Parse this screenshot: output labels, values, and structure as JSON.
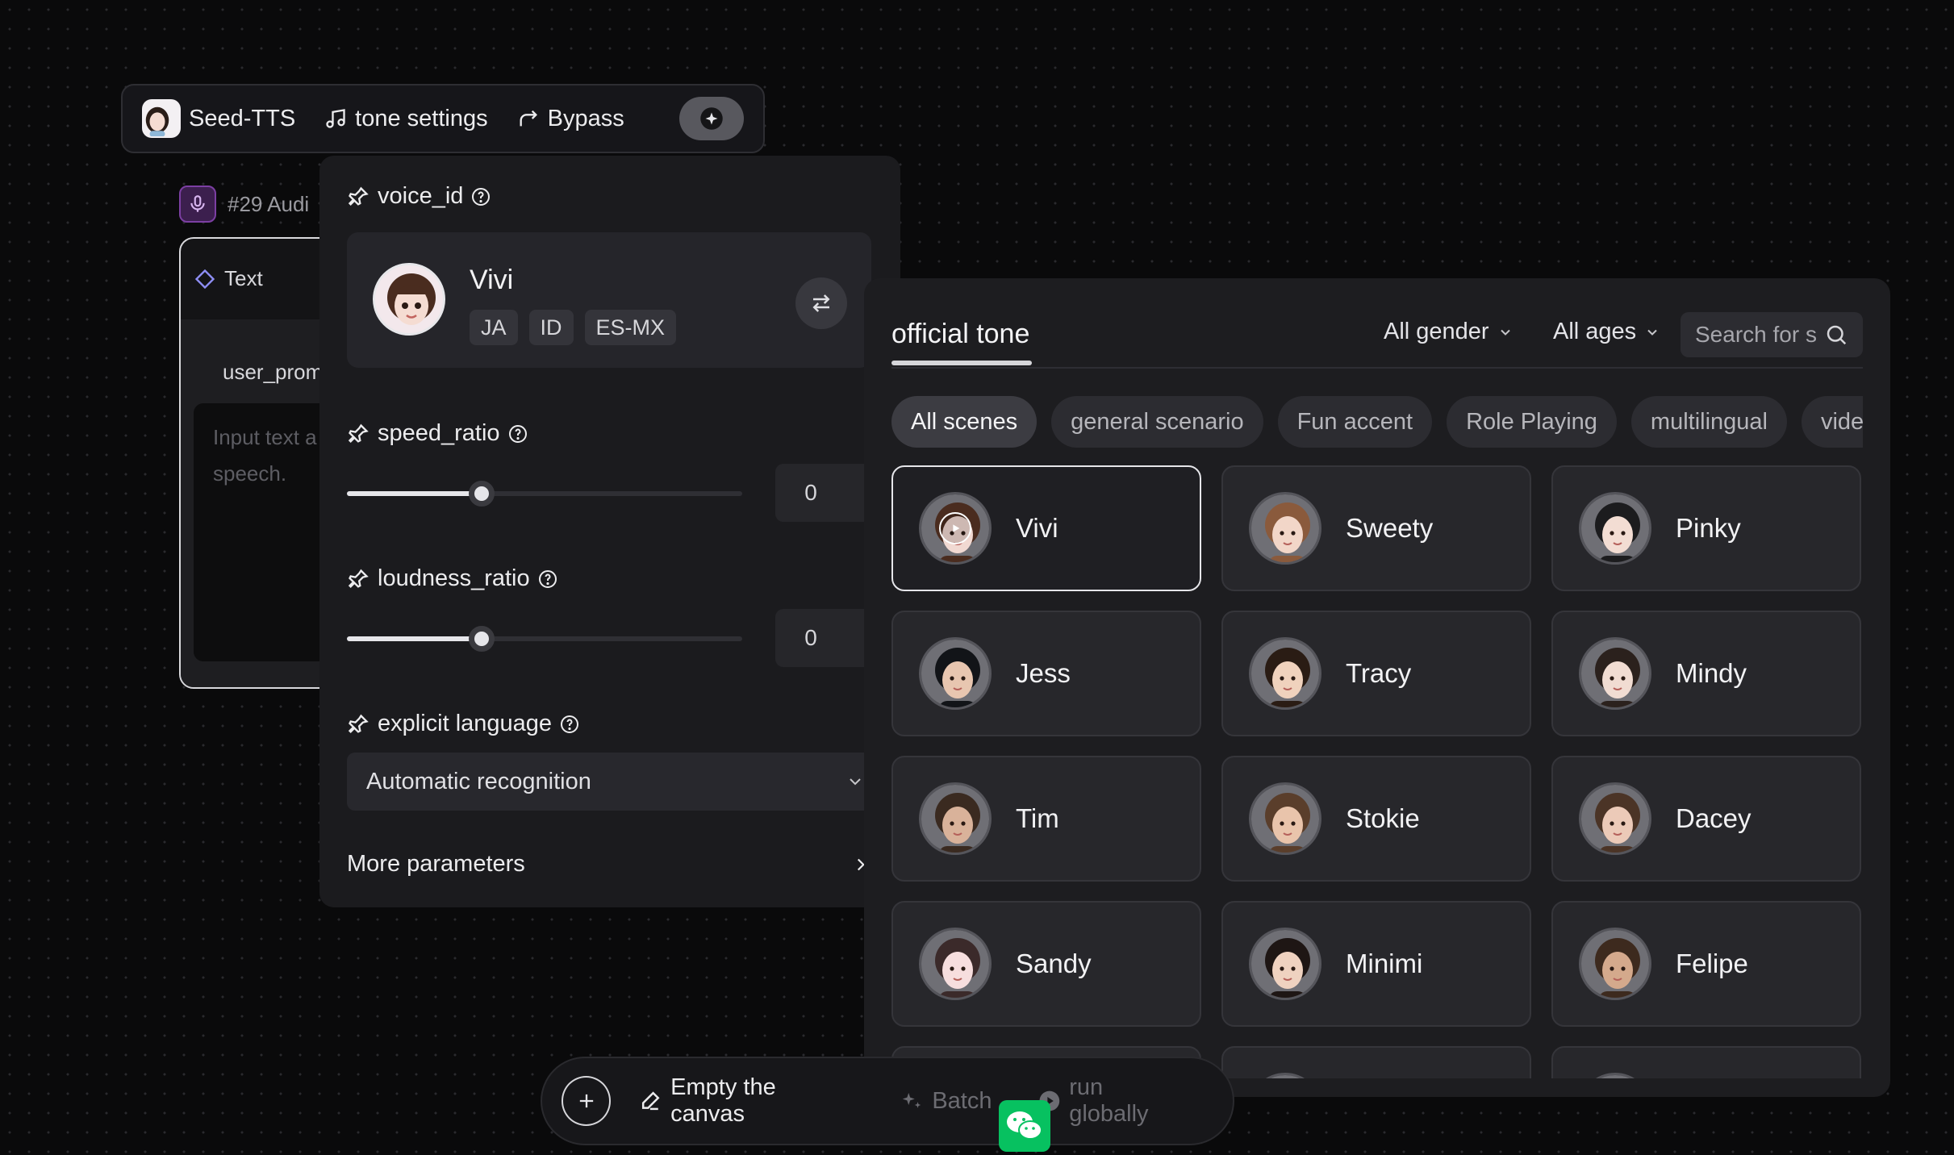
{
  "node_header": {
    "app_name": "Seed-TTS",
    "tone_settings_label": "tone settings",
    "bypass_label": "Bypass"
  },
  "audio_node": {
    "title": "#29 Audi",
    "tab_label": "Text",
    "field_label": "user_prom",
    "placeholder": "Input text a speech."
  },
  "params": {
    "voice_id_label": "voice_id",
    "selected_voice": {
      "name": "Vivi",
      "tags": [
        "JA",
        "ID",
        "ES-MX"
      ]
    },
    "speed_ratio": {
      "label": "speed_ratio",
      "value": "0",
      "slider_fraction": 0.34
    },
    "loudness_ratio": {
      "label": "loudness_ratio",
      "value": "0",
      "slider_fraction": 0.34
    },
    "explicit_language": {
      "label": "explicit language",
      "selected": "Automatic recognition"
    },
    "more_parameters_label": "More parameters"
  },
  "tone_panel": {
    "title": "official tone",
    "gender_filter": "All gender",
    "age_filter": "All ages",
    "search_placeholder": "Search for s",
    "scenes": [
      "All scenes",
      "general scenario",
      "Fun accent",
      "Role Playing",
      "multilingual",
      "video"
    ],
    "active_scene": "All scenes",
    "voices": [
      {
        "name": "Vivi",
        "skin": "#f1d9d2",
        "hair": "#4a2c1f",
        "selected": true
      },
      {
        "name": "Sweety",
        "skin": "#f2d6c8",
        "hair": "#8a5a3c",
        "selected": false
      },
      {
        "name": "Pinky",
        "skin": "#f3ddd3",
        "hair": "#1c1c1e",
        "selected": false
      },
      {
        "name": "Jess",
        "skin": "#e8c6b0",
        "hair": "#121418",
        "selected": false
      },
      {
        "name": "Tracy",
        "skin": "#f0d2bd",
        "hair": "#2a1c14",
        "selected": false
      },
      {
        "name": "Mindy",
        "skin": "#f1dcd2",
        "hair": "#2b211d",
        "selected": false
      },
      {
        "name": "Tim",
        "skin": "#d9b29a",
        "hair": "#3a2a20",
        "selected": false
      },
      {
        "name": "Stokie",
        "skin": "#e9c4ab",
        "hair": "#5a3e2b",
        "selected": false
      },
      {
        "name": "Dacey",
        "skin": "#eccab8",
        "hair": "#4b3426",
        "selected": false
      },
      {
        "name": "Sandy",
        "skin": "#f7dede",
        "hair": "#3b2a2a",
        "selected": false
      },
      {
        "name": "Minimi",
        "skin": "#efd2c0",
        "hair": "#1e1614",
        "selected": false
      },
      {
        "name": "Felipe",
        "skin": "#d4a98c",
        "hair": "#3d2a1e",
        "selected": false
      },
      {
        "name": "",
        "skin": "#cfcfd2",
        "hair": "#2a2a2c",
        "selected": false
      },
      {
        "name": "",
        "skin": "#cfcfd2",
        "hair": "#2a2a2c",
        "selected": false
      },
      {
        "name": "",
        "skin": "#cfcfd2",
        "hair": "#2a2a2c",
        "selected": false
      }
    ]
  },
  "bottom_bar": {
    "empty_canvas_label": "Empty the canvas",
    "batch_label": "Batch",
    "run_globally_label": "run globally"
  },
  "colors": {
    "background": "#0a0a0b",
    "panel": "#1b1b1e",
    "accent": "#e6e6ea",
    "audio_node_accent": "#7c3fa3",
    "wechat": "#07c160"
  }
}
